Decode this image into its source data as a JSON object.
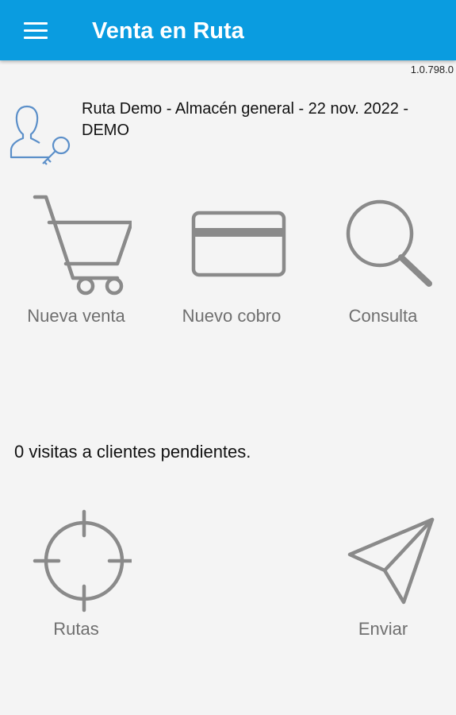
{
  "app": {
    "title": "Venta en Ruta",
    "version": "1.0.798.0",
    "accent_color": "#0a9ce0"
  },
  "header": {
    "menu_icon": "hamburger-menu-icon"
  },
  "session": {
    "icon": "user-key-icon",
    "line1": "Ruta Demo - Almacén general - 22 nov. 2022 -",
    "line2": "DEMO"
  },
  "actions": [
    {
      "label": "Nueva venta",
      "icon": "shopping-cart-icon"
    },
    {
      "label": "Nuevo cobro",
      "icon": "credit-card-icon"
    },
    {
      "label": "Consulta",
      "icon": "search-icon"
    }
  ],
  "pending": {
    "text": "0 visitas a clientes pendientes."
  },
  "bottom_actions": [
    {
      "label": "Rutas",
      "icon": "crosshair-icon"
    },
    {
      "label": "Enviar",
      "icon": "send-icon"
    }
  ]
}
